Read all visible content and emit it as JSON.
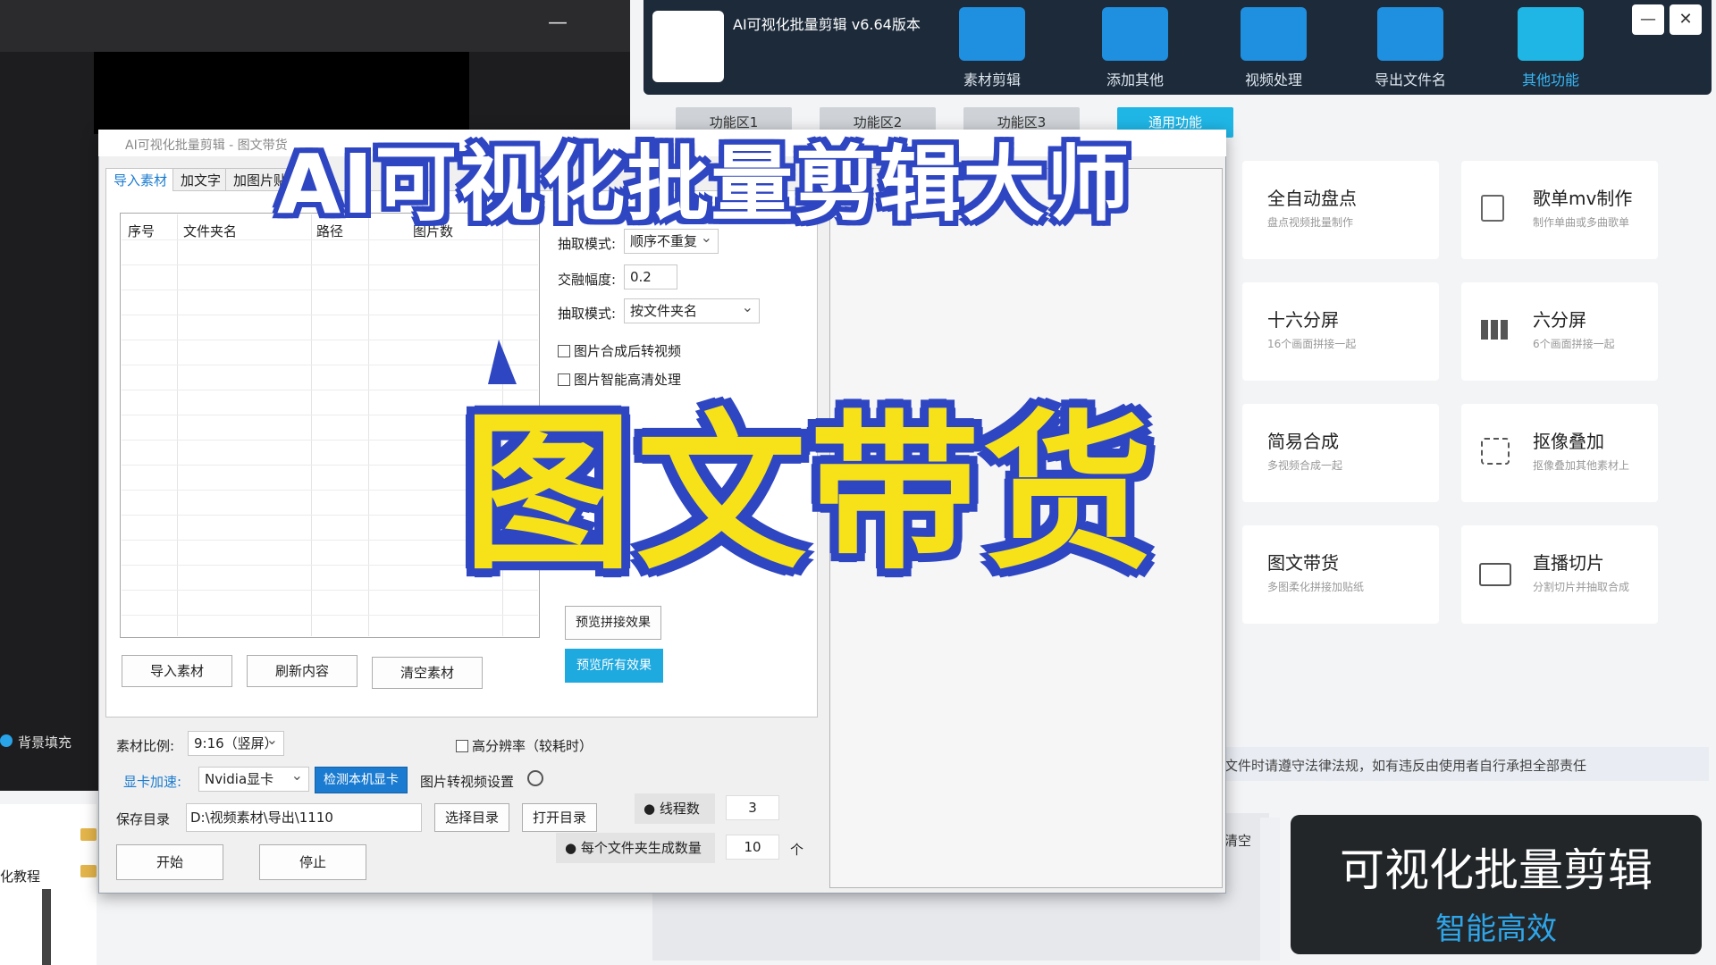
{
  "left_window": {
    "minimize": "—",
    "bg_fill_label": "背景填充",
    "tutorial_label": "化教程"
  },
  "app": {
    "title": "AI可视化批量剪辑 v6.64版本",
    "toolbar": [
      {
        "label": "素材剪辑",
        "icon": "clapperboard-icon",
        "color": "#1f8fe0"
      },
      {
        "label": "添加其他",
        "icon": "add-list-icon",
        "color": "#1f8fe0"
      },
      {
        "label": "视频处理",
        "icon": "sliders-icon",
        "color": "#1f8fe0"
      },
      {
        "label": "导出文件名",
        "icon": "export-folder-icon",
        "color": "#1f8fe0"
      },
      {
        "label": "其他功能",
        "icon": "grid-apps-icon",
        "color": "#1fb6e6"
      }
    ],
    "window_min": "—",
    "window_close": "✕",
    "area_tabs": [
      "功能区1",
      "功能区2",
      "功能区3",
      "通用功能"
    ],
    "cards": [
      {
        "title": "全自动盘点",
        "sub": "盘点视频批量制作"
      },
      {
        "title": "歌单mv制作",
        "sub": "制作单曲或多曲歌单"
      },
      {
        "title": "十六分屏",
        "sub": "16个画面拼接一起"
      },
      {
        "title": "六分屏",
        "sub": "6个画面拼接一起"
      },
      {
        "title": "简易合成",
        "sub": "多视频合成一起"
      },
      {
        "title": "抠像叠加",
        "sub": "抠像叠加其他素材上"
      },
      {
        "title": "图文带货",
        "sub": "多图柔化拼接加贴纸"
      },
      {
        "title": "直播切片",
        "sub": "分割切片并抽取合成"
      }
    ],
    "notice": "文件时请遵守法律法规，如有违反由使用者自行承担全部责任",
    "clear_label": "清空",
    "promo_main": "可视化批量剪辑",
    "promo_sub": "智能高效"
  },
  "dialog": {
    "title": "AI可视化批量剪辑 - 图文带货",
    "tabs": [
      "导入素材",
      "加文字",
      "加图片贴"
    ],
    "table_headers": [
      "序号",
      "文件夹名",
      "路径",
      "图片数"
    ],
    "import_button": "导入素材",
    "refresh_button": "刷新内容",
    "clear_button": "清空素材",
    "extract_mode_label": "抽取模式:",
    "extract_mode_value": "顺序不重复",
    "blend_label": "交融幅度:",
    "blend_value": "0.2",
    "extract_mode2_label": "抽取模式:",
    "extract_mode2_value": "按文件夹名",
    "chk_to_video": "图片合成后转视频",
    "chk_hd": "图片智能高清处理",
    "preview_stitch": "预览拼接效果",
    "preview_all": "预览所有效果",
    "ratio_label": "素材比例:",
    "ratio_value": "9:16（竖屏）",
    "hires_label": "高分辨率（较耗时）",
    "gpu_label": "显卡加速:",
    "gpu_value": "Nvidia显卡",
    "detect_gpu": "检测本机显卡",
    "img2vid_settings": "图片转视频设置",
    "save_label": "保存目录",
    "save_path": "D:\\视频素材\\导出\\1110",
    "choose_dir": "选择目录",
    "open_dir": "打开目录",
    "threads_label": "● 线程数",
    "threads_value": "3",
    "per_folder_label": "● 每个文件夹生成数量",
    "per_folder_value": "10",
    "per_folder_unit": "个",
    "start": "开始",
    "stop": "停止"
  },
  "overlay": {
    "title": "AI可视化批量剪辑大师",
    "main": "图文带货",
    "colors": {
      "outline": "#2f46c2",
      "main_fill": "#f7e21a",
      "title_fill": "#ffffff"
    }
  }
}
